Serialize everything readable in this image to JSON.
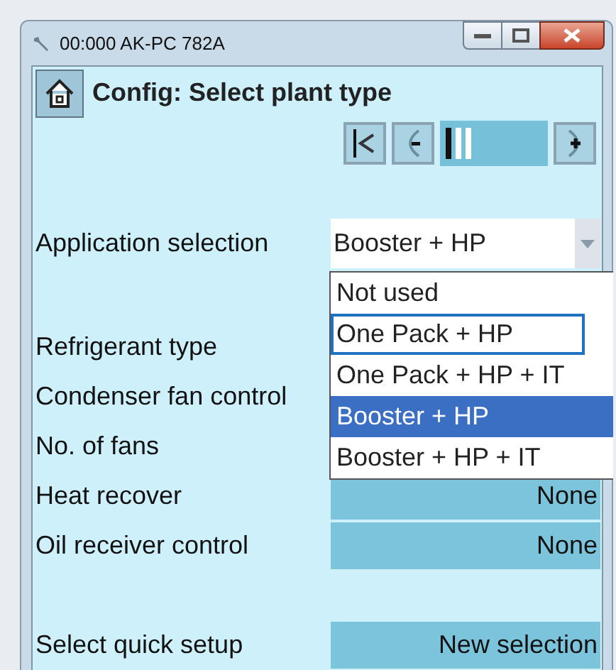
{
  "window": {
    "title": "00:000 AK-PC 782A"
  },
  "header": {
    "title": "Config: Select plant type"
  },
  "application": {
    "label": "Application selection",
    "value": "Booster + HP",
    "expanded": true,
    "options": [
      {
        "label": "Not used",
        "selected": false,
        "focused": false
      },
      {
        "label": "One Pack + HP",
        "selected": false,
        "focused": true
      },
      {
        "label": "One Pack + HP + IT",
        "selected": false,
        "focused": false
      },
      {
        "label": "Booster + HP",
        "selected": true,
        "focused": false
      },
      {
        "label": "Booster + HP + IT",
        "selected": false,
        "focused": false
      }
    ]
  },
  "settings": [
    {
      "label": "Refrigerant type"
    },
    {
      "label": "Condenser fan control"
    },
    {
      "label": "No. of fans"
    },
    {
      "label": "Heat recover",
      "value": "None"
    },
    {
      "label": "Oil receiver control",
      "value": "None"
    }
  ],
  "quick_setup": {
    "label": "Select quick setup",
    "value": "New selection"
  }
}
